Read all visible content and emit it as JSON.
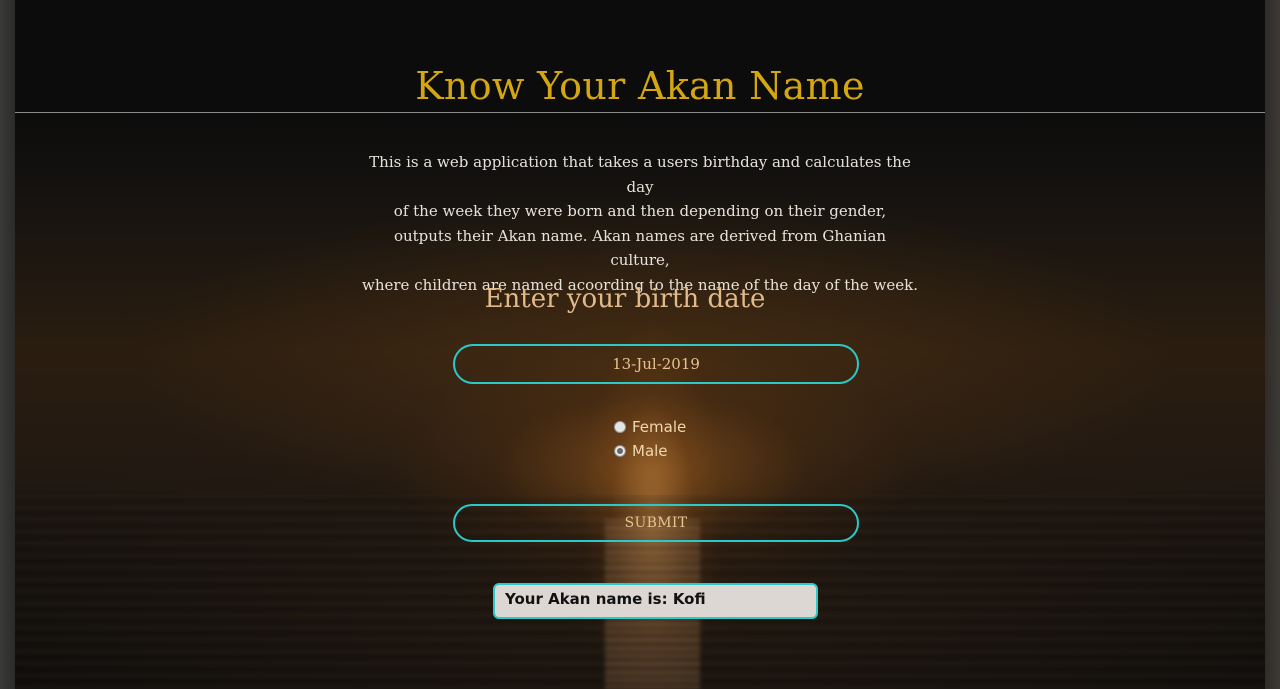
{
  "header": {
    "title": "Know Your Akan Name"
  },
  "main": {
    "description_lines": [
      "This is a web application that takes a users birthday and calculates the day",
      "of the week they were born and then depending on their gender,",
      "outputs their Akan name. Akan names are derived from Ghanian culture,",
      "where children are named acoording to the name of the day of the week."
    ],
    "form": {
      "heading": "Enter your birth date",
      "date_value": "13-Jul-2019",
      "gender_options": [
        {
          "label": "Female",
          "checked": false
        },
        {
          "label": "Male",
          "checked": true
        }
      ],
      "submit_label": "SUBMIT"
    },
    "result": {
      "text": "Your Akan name is: Kofi"
    }
  },
  "colors": {
    "title": "#d4a611",
    "accent_border": "#2cc9c9",
    "heading": "#e2b989",
    "result_background": "#ddd7d4"
  }
}
